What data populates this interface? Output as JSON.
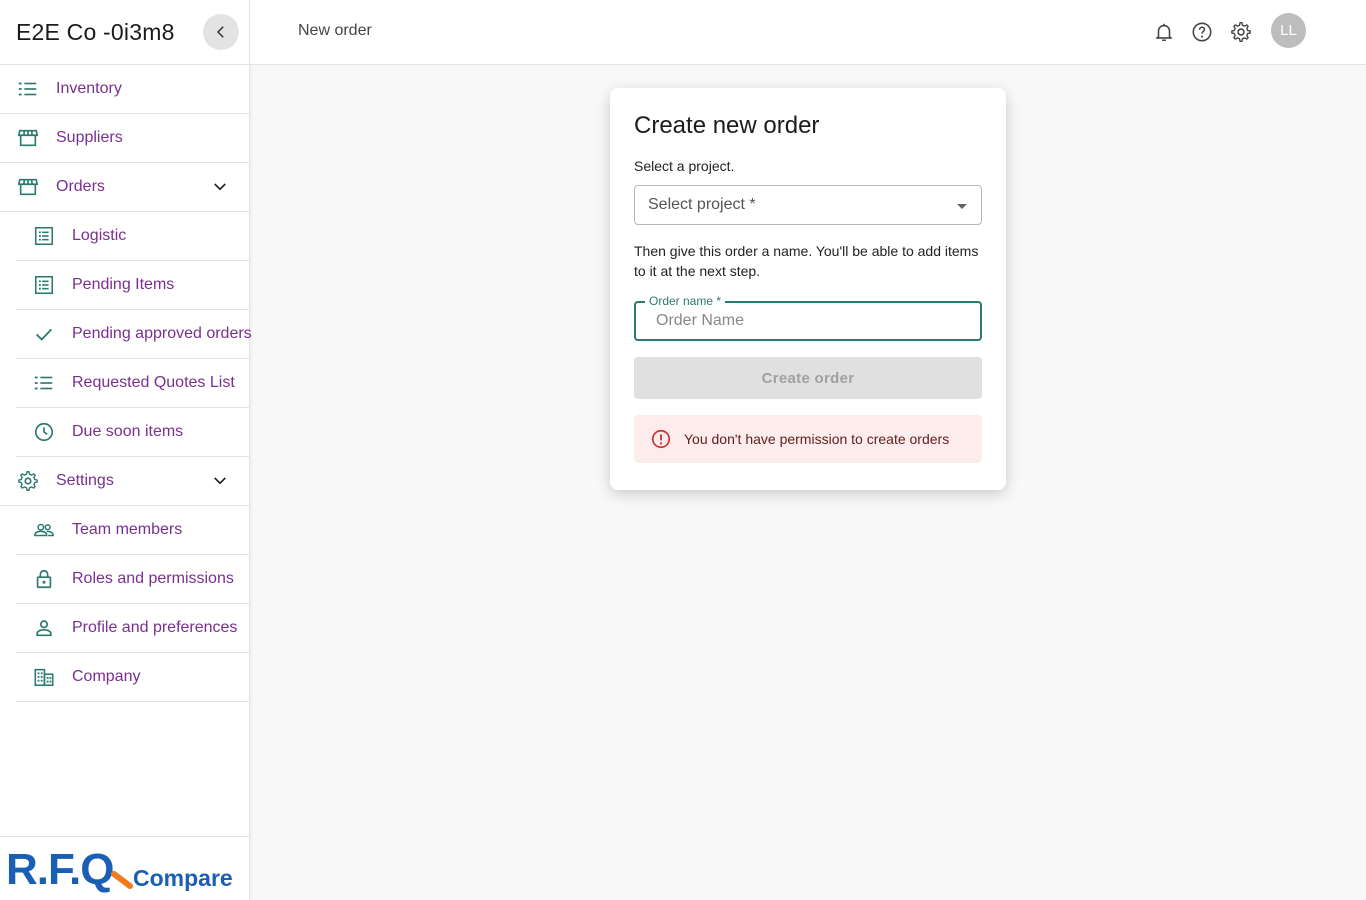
{
  "sidebar": {
    "brand": "E2E Co -0i3m8",
    "items": [
      {
        "label": "Inventory"
      },
      {
        "label": "Suppliers"
      },
      {
        "label": "Orders"
      },
      {
        "label": "Logistic"
      },
      {
        "label": "Pending Items"
      },
      {
        "label": "Pending approved orders"
      },
      {
        "label": "Requested Quotes List"
      },
      {
        "label": "Due soon items"
      },
      {
        "label": "Settings"
      },
      {
        "label": "Team members"
      },
      {
        "label": "Roles and permissions"
      },
      {
        "label": "Profile and preferences"
      },
      {
        "label": "Company"
      }
    ],
    "logo": {
      "primary": "R.F.Q",
      "secondary": "Compare"
    }
  },
  "header": {
    "title": "New order",
    "avatar_initials": "LL"
  },
  "card": {
    "title": "Create new order",
    "project_instruction": "Select a project.",
    "project_placeholder": "Select project *",
    "name_instruction": "Then give this order a name. You'll be able to add items to it at the next step.",
    "name_label": "Order name *",
    "name_placeholder": "Order Name",
    "name_value": "",
    "create_label": "Create order",
    "alert_text": "You don't have permission to create orders"
  },
  "colors": {
    "accent": "#2b7a6f",
    "nav_text": "#7a2f8f",
    "logo_blue": "#1a5fb4",
    "logo_orange": "#f07c1e",
    "alert_bg": "#fdecec",
    "alert_icon": "#d32f2f"
  }
}
